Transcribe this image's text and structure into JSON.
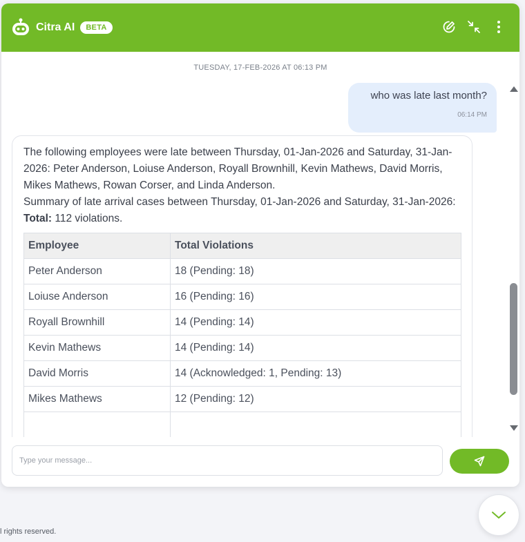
{
  "app": {
    "title": "Citra AI",
    "badge": "BETA"
  },
  "header": {
    "actions": [
      "edit-icon",
      "minimize-icon",
      "more-vertical-icon"
    ]
  },
  "conversation": {
    "date_stamp": "TUESDAY, 17-FEB-2026 AT 06:13 PM",
    "user_message": {
      "text": "who was late last month?",
      "time": "06:14 PM"
    },
    "bot_message": {
      "intro": "The following employees were late between Thursday, 01-Jan-2026 and Saturday, 31-Jan-2026: Peter Anderson, Loiuse Anderson, Royall Brownhill, Kevin Mathews, David Morris, Mikes Mathews, Rowan Corser, and Linda Anderson.",
      "summary": "Summary of late arrival cases between Thursday, 01-Jan-2026 and Saturday, 31-Jan-2026:",
      "total_label": "Total:",
      "total_value": "112 violations.",
      "table": {
        "headers": [
          "Employee",
          "Total Violations"
        ],
        "rows": [
          [
            "Peter Anderson",
            "18 (Pending: 18)"
          ],
          [
            "Loiuse Anderson",
            "16 (Pending: 16)"
          ],
          [
            "Royall Brownhill",
            "14 (Pending: 14)"
          ],
          [
            "Kevin Mathews",
            "14 (Pending: 14)"
          ],
          [
            "David Morris",
            "14 (Acknowledged: 1, Pending: 13)"
          ],
          [
            "Mikes Mathews",
            "12 (Pending: 12)"
          ],
          [
            "",
            ""
          ]
        ]
      }
    }
  },
  "composer": {
    "placeholder": "Type your message...",
    "value": ""
  },
  "footer": {
    "text": "l rights reserved."
  },
  "colors": {
    "brand": "#72ba27",
    "user_bubble": "#e4eefc",
    "table_header": "#efefef"
  }
}
